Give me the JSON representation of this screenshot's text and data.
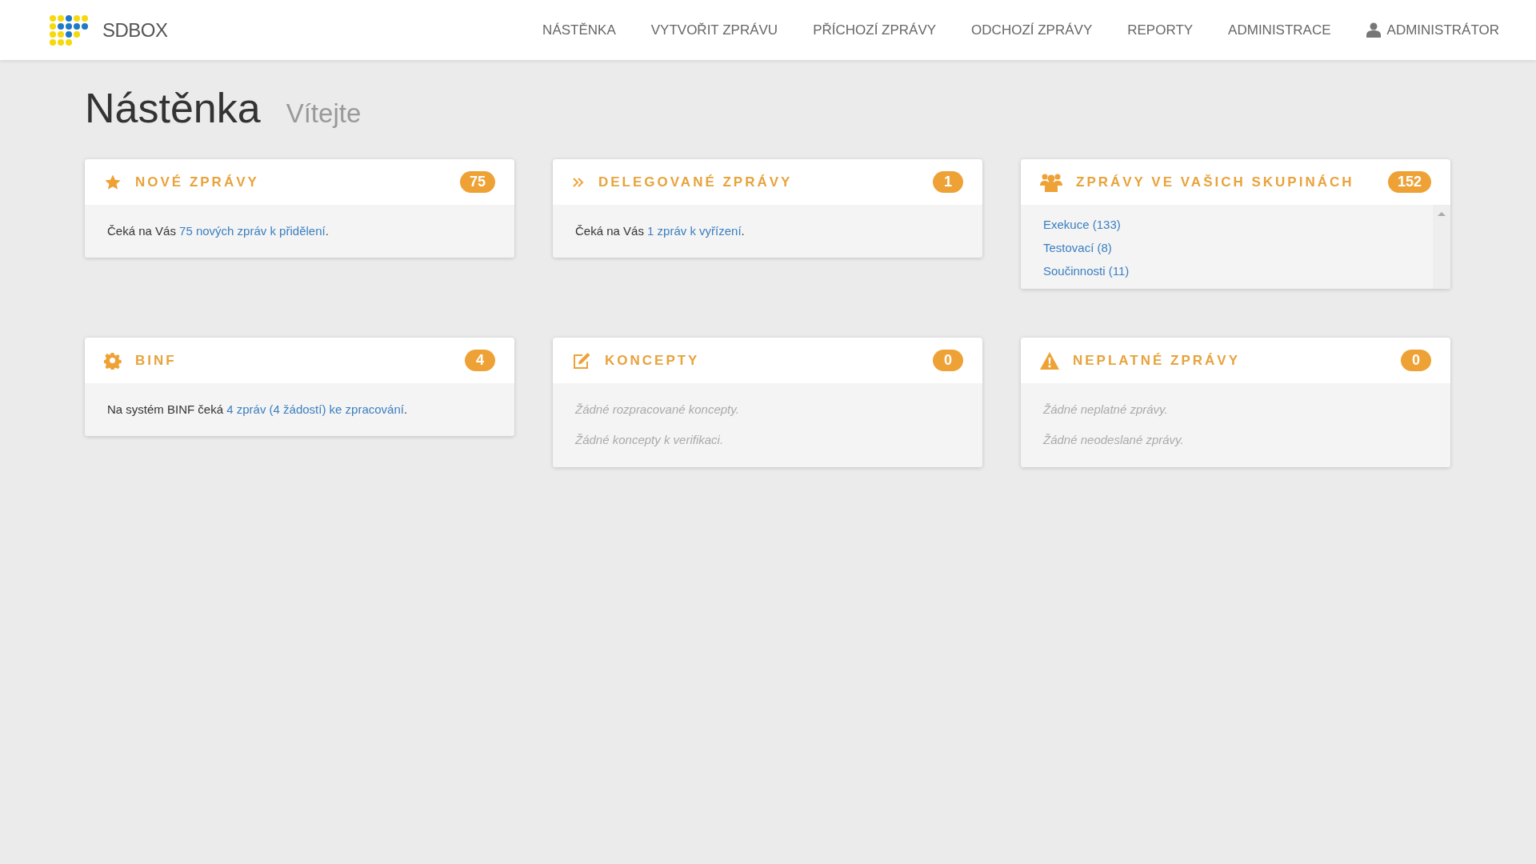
{
  "header": {
    "brand": "SDBOX",
    "nav": [
      {
        "label": "NÁSTĚNKA"
      },
      {
        "label": "VYTVOŘIT ZPRÁVU"
      },
      {
        "label": "PŘÍCHOZÍ ZPRÁVY"
      },
      {
        "label": "ODCHOZÍ ZPRÁVY"
      },
      {
        "label": "REPORTY"
      },
      {
        "label": "ADMINISTRACE"
      }
    ],
    "user_menu": {
      "label": "ADMINISTRÁTOR"
    }
  },
  "page": {
    "title": "Nástěnka",
    "subtitle": "Vítejte"
  },
  "cards": [
    {
      "title": "NOVÉ ZPRÁVY",
      "count": "75",
      "kind": "text",
      "text": "Čeká na Vás ",
      "link": "75 nových zpráv k přidělení",
      "suffix": "."
    },
    {
      "title": "DELEGOVANÉ ZPRÁVY",
      "count": "1",
      "kind": "text",
      "text": "Čeká na Vás ",
      "link": "1 zpráv k vyřízení",
      "suffix": "."
    },
    {
      "title": "ZPRÁVY VE VAŠICH SKUPINÁCH",
      "count": "152",
      "kind": "links",
      "links": [
        "Exekuce (133)",
        "Testovací (8)",
        "Součinnosti (11)"
      ]
    },
    {
      "title": "BINF",
      "count": "4",
      "kind": "text",
      "text": "Na systém BINF čeká ",
      "link": "4 zpráv (4 žádostí) ke zpracování",
      "suffix": "."
    },
    {
      "title": "KONCEPTY",
      "count": "0",
      "kind": "empty",
      "lines": [
        "Žádné rozpracované koncepty.",
        "Žádné koncepty k verifikaci."
      ]
    },
    {
      "title": "NEPLATNÉ ZPRÁVY",
      "count": "0",
      "kind": "empty",
      "lines": [
        "Žádné neplatné zprávy.",
        "Žádné neodeslané zprávy."
      ]
    }
  ]
}
